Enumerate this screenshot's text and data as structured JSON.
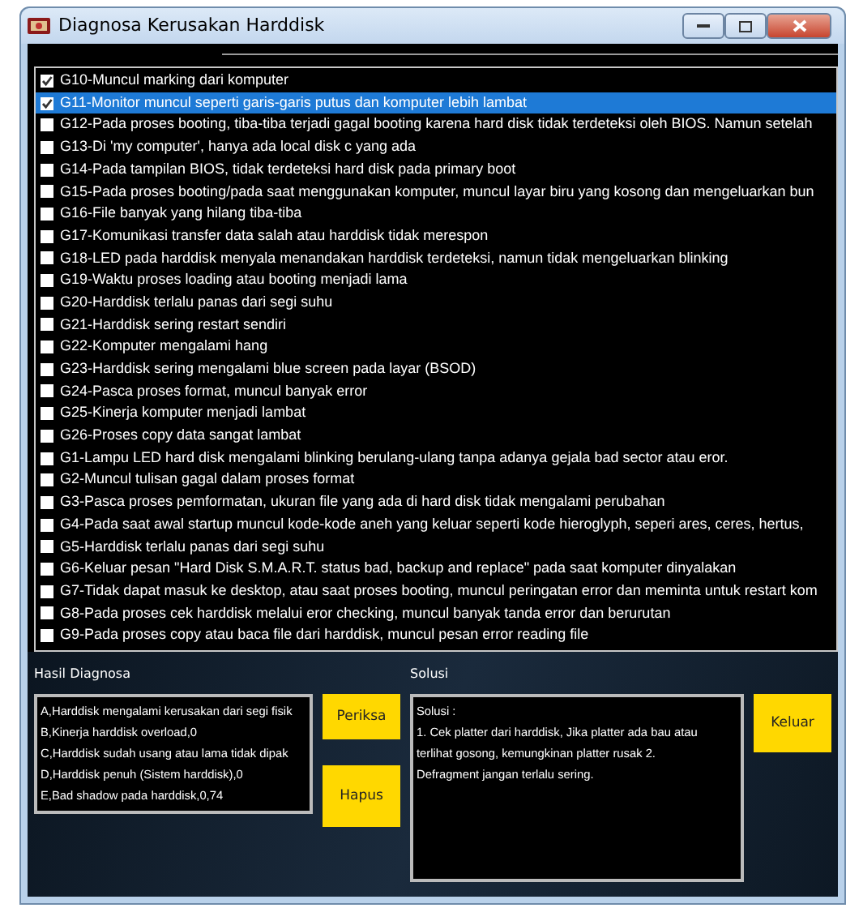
{
  "window": {
    "title": "Diagnosa Kerusakan Harddisk"
  },
  "symptoms": [
    {
      "label": "G10-Muncul marking dari komputer",
      "checked": true,
      "selected": false
    },
    {
      "label": "G11-Monitor muncul seperti garis-garis putus dan komputer lebih lambat",
      "checked": true,
      "selected": true
    },
    {
      "label": "G12-Pada proses booting, tiba-tiba terjadi gagal booting karena hard disk tidak terdeteksi oleh BIOS. Namun setelah",
      "checked": false,
      "selected": false
    },
    {
      "label": "G13-Di 'my computer', hanya ada local disk c yang ada",
      "checked": false,
      "selected": false
    },
    {
      "label": "G14-Pada tampilan BIOS, tidak terdeteksi hard disk pada primary boot",
      "checked": false,
      "selected": false
    },
    {
      "label": "G15-Pada proses booting/pada saat menggunakan komputer, muncul layar biru yang kosong dan mengeluarkan bun",
      "checked": false,
      "selected": false
    },
    {
      "label": "G16-File banyak yang hilang tiba-tiba",
      "checked": false,
      "selected": false
    },
    {
      "label": "G17-Komunikasi transfer data salah atau harddisk tidak merespon",
      "checked": false,
      "selected": false
    },
    {
      "label": "G18-LED pada harddisk menyala menandakan harddisk terdeteksi, namun tidak mengeluarkan blinking",
      "checked": false,
      "selected": false
    },
    {
      "label": "G19-Waktu proses loading atau booting menjadi lama",
      "checked": false,
      "selected": false
    },
    {
      "label": "G20-Harddisk terlalu panas dari segi suhu",
      "checked": false,
      "selected": false
    },
    {
      "label": "G21-Harddisk sering restart sendiri",
      "checked": false,
      "selected": false
    },
    {
      "label": "G22-Komputer mengalami hang",
      "checked": false,
      "selected": false
    },
    {
      "label": "G23-Harddisk sering mengalami blue screen pada layar (BSOD)",
      "checked": false,
      "selected": false
    },
    {
      "label": "G24-Pasca proses format, muncul banyak error",
      "checked": false,
      "selected": false
    },
    {
      "label": "G25-Kinerja komputer menjadi lambat",
      "checked": false,
      "selected": false
    },
    {
      "label": "G26-Proses copy data sangat lambat",
      "checked": false,
      "selected": false
    },
    {
      "label": "G1-Lampu LED hard disk mengalami blinking berulang-ulang tanpa adanya gejala bad sector atau eror.",
      "checked": false,
      "selected": false
    },
    {
      "label": "G2-Muncul tulisan gagal dalam proses format",
      "checked": false,
      "selected": false
    },
    {
      "label": "G3-Pasca proses pemformatan, ukuran file yang ada di hard disk tidak mengalami perubahan",
      "checked": false,
      "selected": false
    },
    {
      "label": "G4-Pada saat awal startup muncul kode-kode aneh yang keluar seperti kode hieroglyph, seperi ares, ceres, hertus,",
      "checked": false,
      "selected": false
    },
    {
      "label": "G5-Harddisk terlalu panas dari segi suhu",
      "checked": false,
      "selected": false
    },
    {
      "label": "G6-Keluar pesan \"Hard Disk S.M.A.R.T. status bad, backup and replace\" pada saat komputer dinyalakan",
      "checked": false,
      "selected": false
    },
    {
      "label": "G7-Tidak dapat masuk ke desktop, atau saat proses booting, muncul peringatan error dan meminta untuk restart kom",
      "checked": false,
      "selected": false
    },
    {
      "label": "G8-Pada proses cek harddisk melalui eror checking, muncul banyak tanda error dan berurutan",
      "checked": false,
      "selected": false
    },
    {
      "label": "G9-Pada proses copy atau baca file dari harddisk, muncul pesan error reading file",
      "checked": false,
      "selected": false
    }
  ],
  "diagnosis": {
    "label": "Hasil Diagnosa",
    "lines": [
      "A,Harddisk mengalami kerusakan dari segi fisik",
      "B,Kinerja harddisk overload,0",
      "C,Harddisk sudah usang atau lama tidak dipak",
      "D,Harddisk penuh (Sistem harddisk),0",
      "E,Bad shadow pada harddisk,0,74"
    ],
    "buttons": [
      "Periksa",
      "Hapus"
    ]
  },
  "solution": {
    "label": "Solusi",
    "lines": [
      "Solusi :",
      "1. Cek platter dari harddisk, Jika platter ada bau atau",
      "terlihat gosong, kemungkinan platter rusak 2.",
      "Defragment jangan terlalu sering."
    ],
    "buttons": [
      "Keluar"
    ]
  }
}
